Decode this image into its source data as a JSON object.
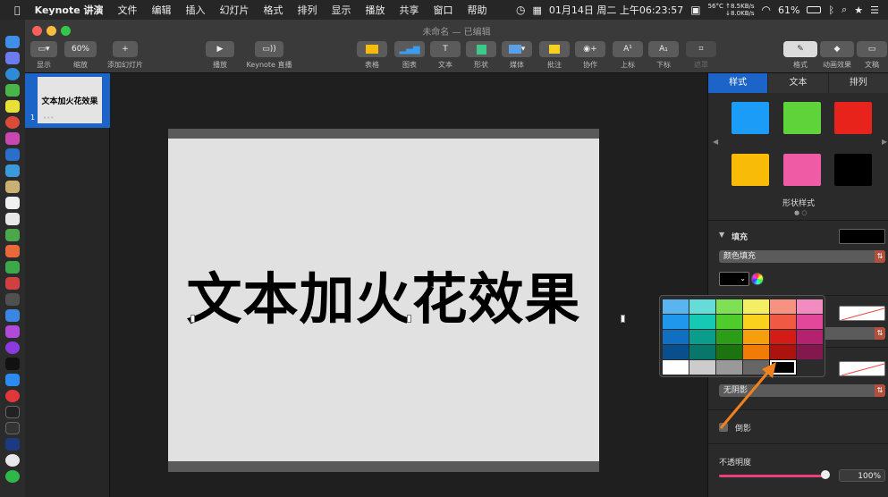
{
  "menubar": {
    "apple": "",
    "app_name": "Keynote 讲演",
    "items": [
      "文件",
      "编辑",
      "插入",
      "幻灯片",
      "格式",
      "排列",
      "显示",
      "播放",
      "共享",
      "窗口",
      "帮助"
    ],
    "temp": "56°C",
    "up_speed": "↑8.5KB/s",
    "down_speed": "↓8.0KB/s",
    "datetime": "01月14日 周二 上午06:23:57",
    "battery": "61%"
  },
  "window": {
    "title": "未命名 — 已编辑"
  },
  "toolbar": {
    "view": "显示",
    "zoom_value": "60%",
    "zoom": "缩放",
    "add_slide": "添加幻灯片",
    "play": "播放",
    "keynote_live": "Keynote 直播",
    "table": "表格",
    "chart": "图表",
    "text": "文本",
    "shape": "形状",
    "media": "媒体",
    "comment": "批注",
    "collaborate": "协作",
    "superscript": "上标",
    "subscript": "下标",
    "mask": "遮罩",
    "format": "格式",
    "animate": "动画效果",
    "document": "文稿",
    "icons": {
      "superscript": "A¹",
      "subscript": "A₁"
    }
  },
  "navigator": {
    "slide_number": "1",
    "thumb_text": "文本加火花效果"
  },
  "slide": {
    "text": "文本加火花效果"
  },
  "inspector": {
    "tabs": [
      "样式",
      "文本",
      "排列"
    ],
    "style_label": "形状样式",
    "fill_label": "填充",
    "fill_type": "颜色填充",
    "shadow_value": "无阴影",
    "reflection_label": "倒影",
    "opacity_label": "不透明度",
    "opacity_value": "100%",
    "style_colors": [
      "#1a9cf7",
      "#5fd43a",
      "#e8231c",
      "#f8bb08",
      "#ef5ba4",
      "#000000"
    ]
  },
  "palette": {
    "rows": [
      [
        "#5ab4f0",
        "#66dcd8",
        "#7ee055",
        "#f3ee62",
        "#f59380",
        "#f28cc0"
      ],
      [
        "#1f97ec",
        "#16c9b4",
        "#4fcb2b",
        "#fad21e",
        "#f05a45",
        "#e3479a"
      ],
      [
        "#106fc0",
        "#0b9d8b",
        "#2b9d16",
        "#f79e0c",
        "#d21c15",
        "#b3216f"
      ],
      [
        "#0a4f8d",
        "#08766a",
        "#1c7410",
        "#f07c07",
        "#ac130e",
        "#83184f"
      ],
      [
        "#ffffff",
        "#cccccc",
        "#999999",
        "#666666",
        "#000000",
        "#2b2b2b"
      ]
    ],
    "selected": "#000000"
  }
}
